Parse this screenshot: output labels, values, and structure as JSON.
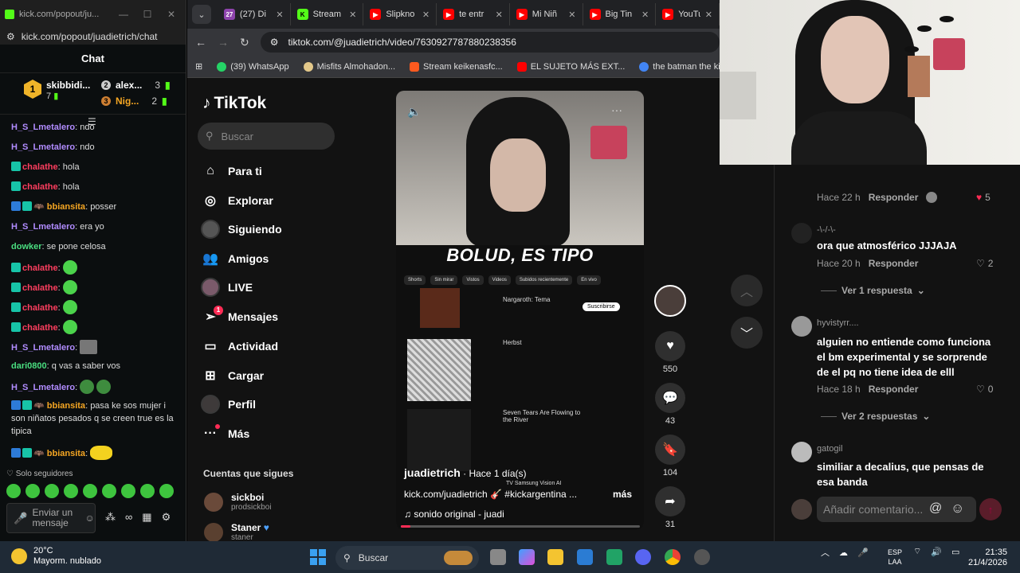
{
  "kick": {
    "window_title": "kick.com/popout/ju...",
    "url": "kick.com/popout/juadietrich/chat",
    "chat_title": "Chat",
    "top_gifter": {
      "rank": "1",
      "name": "skibbidi...",
      "count": "7"
    },
    "gifters": [
      {
        "rank": "2",
        "name": "alex...",
        "count": "3"
      },
      {
        "rank": "3",
        "name": "Nig...",
        "count": "2"
      }
    ],
    "messages": [
      {
        "user": "H_S_Lmetalero",
        "text": "ndo",
        "color": "purple"
      },
      {
        "user": "H_S_Lmetalero",
        "text": "ndo",
        "color": "purple"
      },
      {
        "user": "chalathe",
        "text": "hola",
        "color": "red"
      },
      {
        "user": "chalathe",
        "text": "hola",
        "color": "red"
      },
      {
        "user": "bbiansita",
        "text": "posser",
        "color": "orange"
      },
      {
        "user": "H_S_Lmetalero",
        "text": "era yo",
        "color": "purple"
      },
      {
        "user": "dowker",
        "text": "se pone celosa",
        "color": "green"
      },
      {
        "user": "chalathe",
        "text": "",
        "color": "red"
      },
      {
        "user": "chalathe",
        "text": "",
        "color": "red"
      },
      {
        "user": "chalathe",
        "text": "",
        "color": "red"
      },
      {
        "user": "chalathe",
        "text": "",
        "color": "red"
      },
      {
        "user": "H_S_Lmetalero",
        "text": "",
        "color": "purple"
      },
      {
        "user": "dari0800",
        "text": "q vas a saber vos",
        "color": "green"
      },
      {
        "user": "H_S_Lmetalero",
        "text": "",
        "color": "purple"
      },
      {
        "user": "bbiansita",
        "text": "pasa ke sos mujer i son niñatos pesados q se creen true es la tipica",
        "color": "orange"
      },
      {
        "user": "bbiansita",
        "text": "",
        "color": "orange"
      }
    ],
    "followers_only": "Solo seguidores",
    "input_placeholder": "Enviar un mensaje"
  },
  "browser": {
    "tabs": [
      {
        "label": "(27) Di",
        "fav_color": "#8e44ad",
        "fav_text": "27"
      },
      {
        "label": "Stream",
        "fav_color": "#53fc18",
        "fav_text": "K"
      },
      {
        "label": "Slipkno",
        "fav_color": "#ff0000",
        "fav_text": "▶"
      },
      {
        "label": "te entr",
        "fav_color": "#ff0000",
        "fav_text": "▶"
      },
      {
        "label": "Mi Niñ",
        "fav_color": "#ff0000",
        "fav_text": "▶"
      },
      {
        "label": "Big Tin",
        "fav_color": "#ff0000",
        "fav_text": "▶"
      },
      {
        "label": "YouTu",
        "fav_color": "#ff0000",
        "fav_text": "▶"
      }
    ],
    "url": "tiktok.com/@juadietrich/video/7630927787880238356",
    "bookmarks": [
      {
        "label": "(39) WhatsApp",
        "color": "#25d366"
      },
      {
        "label": "Misfits Almohadon...",
        "color": "#e3c88a"
      },
      {
        "label": "Stream keikenasfc...",
        "color": "#ff5a1f"
      },
      {
        "label": "EL SUJETO MÁS EXT...",
        "color": "#ff0000"
      },
      {
        "label": "the batman the killi...",
        "color": "#4285f4"
      }
    ]
  },
  "tiktok": {
    "logo": "TikTok",
    "search_placeholder": "Buscar",
    "nav": [
      {
        "label": "Para ti",
        "icon": "home-icon"
      },
      {
        "label": "Explorar",
        "icon": "compass-icon"
      },
      {
        "label": "Siguiendo",
        "icon": "avatar"
      },
      {
        "label": "Amigos",
        "icon": "friends-icon"
      },
      {
        "label": "LIVE",
        "icon": "live-icon"
      },
      {
        "label": "Mensajes",
        "icon": "send-icon"
      },
      {
        "label": "Actividad",
        "icon": "inbox-icon"
      },
      {
        "label": "Cargar",
        "icon": "upload-icon"
      },
      {
        "label": "Perfil",
        "icon": "profile-icon"
      },
      {
        "label": "Más",
        "icon": "more-icon"
      }
    ],
    "messages_badge": "1",
    "following_title": "Cuentas que sigues",
    "following": [
      {
        "name": "sickboi",
        "handle": "prodsickboi"
      },
      {
        "name": "Staner",
        "handle": "staner"
      }
    ],
    "video": {
      "caption_overlay": "BOLUD, ES TIPO",
      "author": "juadietrich",
      "time": "· Hace 1 día(s)",
      "description": "kick.com/juadietrich 🎸 #kickargentina ...",
      "more": "más",
      "sound": "♫ sonido original - juadi",
      "progress": 0.04,
      "yt_chips": [
        "Shorts",
        "Sin mirar",
        "Vistos",
        "Videos",
        "Subidos recientemente",
        "En vivo"
      ],
      "yt_channel": "Nargaroth: Tema",
      "yt_subscribe": "Suscribirse",
      "yt_video1_title": "Herbst",
      "yt_video2_title": "Seven Tears Are Flowing to the River",
      "yt_footer": "TV Samsung Vision AI"
    },
    "actions": {
      "likes": "550",
      "comments": "43",
      "saves": "104",
      "shares": "31"
    },
    "comments": [
      {
        "user": "",
        "text": "",
        "time": "Hace 22 h",
        "reply": "Responder",
        "likes": "5",
        "liked": true
      },
      {
        "user": "-\\-/-\\-",
        "text": "ora que atmosférico JJJAJA",
        "time": "Hace 20 h",
        "reply": "Responder",
        "likes": "2",
        "liked": false
      },
      {
        "user": "hyvistyrr....",
        "text": "alguien no entiende como funciona el bm experimental y se sorprende de el pq no tiene idea de elll",
        "time": "Hace 18 h",
        "reply": "Responder",
        "likes": "0",
        "liked": false
      },
      {
        "user": "gatogil",
        "text": "similiar a decalius, que pensas de esa banda",
        "time": "",
        "reply": "",
        "likes": "",
        "liked": false
      }
    ],
    "view_replies_1": "Ver 1 respuesta",
    "view_replies_2": "Ver 2 respuestas",
    "comment_placeholder": "Añadir comentario..."
  },
  "taskbar": {
    "temp": "20°C",
    "weather": "Mayorm. nublado",
    "search": "Buscar",
    "lang1": "ESP",
    "lang2": "LAA",
    "time": "21:35",
    "date": "21/4/2026"
  }
}
